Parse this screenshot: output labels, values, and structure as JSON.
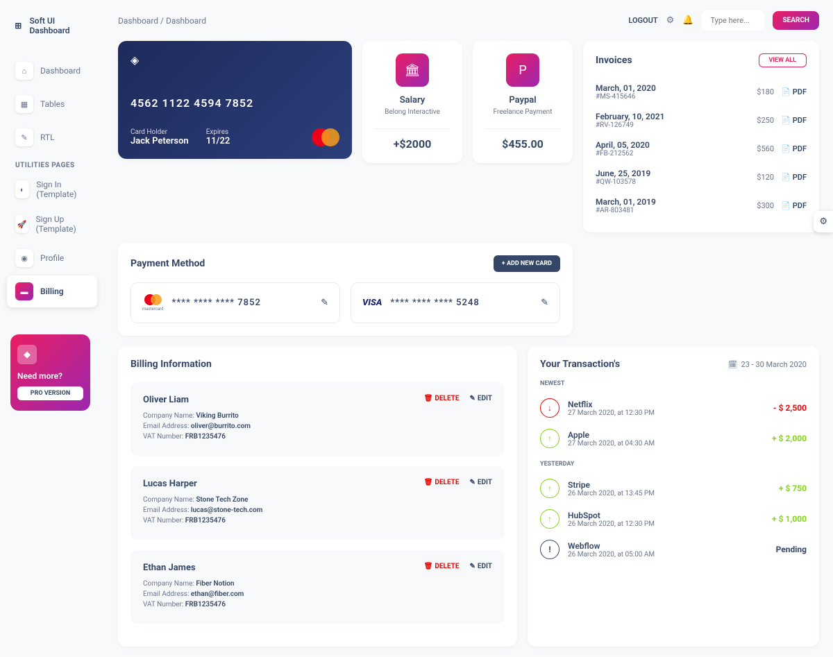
{
  "logo": "Soft UI Dashboard",
  "nav": {
    "items": [
      "Dashboard",
      "Tables",
      "RTL"
    ],
    "section": "UTILITIES PAGES",
    "util_items": [
      "Sign In (Template)",
      "Sign Up (Template)",
      "Profile",
      "Billing"
    ]
  },
  "promo": {
    "title": "Need more?",
    "btn": "PRO VERSION"
  },
  "breadcrumb": {
    "root": "Dashboard",
    "current": "Dashboard"
  },
  "topbar": {
    "logout": "LOGOUT",
    "search_placeholder": "Type here...",
    "search_btn": "SEARCH"
  },
  "credit_card": {
    "number": "4562  1122  4594  7852",
    "holder_label": "Card Holder",
    "holder": "Jack Peterson",
    "exp_label": "Expires",
    "exp": "11/22"
  },
  "stats": [
    {
      "title": "Salary",
      "sub": "Belong Interactive",
      "value": "+$2000"
    },
    {
      "title": "Paypal",
      "sub": "Freelance Payment",
      "value": "$455.00"
    }
  ],
  "invoices": {
    "title": "Invoices",
    "viewall": "VIEW ALL",
    "pdf": "PDF",
    "rows": [
      {
        "date": "March, 01, 2020",
        "id": "#MS-415646",
        "amount": "$180"
      },
      {
        "date": "February, 10, 2021",
        "id": "#RV-126749",
        "amount": "$250"
      },
      {
        "date": "April, 05, 2020",
        "id": "#FB-212562",
        "amount": "$560"
      },
      {
        "date": "June, 25, 2019",
        "id": "#QW-103578",
        "amount": "$120"
      },
      {
        "date": "March, 01, 2019",
        "id": "#AR-803481",
        "amount": "$300"
      }
    ]
  },
  "payment": {
    "title": "Payment Method",
    "add": "+ ADD NEW CARD",
    "mc": "****  ****  ****  7852",
    "mc_label": "mastercard",
    "visa": "****  ****  ****  5248",
    "visa_label": "VISA"
  },
  "billing": {
    "title": "Billing Information",
    "labels": {
      "company": "Company Name:",
      "email": "Email Address:",
      "vat": "VAT Number:"
    },
    "actions": {
      "delete": "DELETE",
      "edit": "EDIT"
    },
    "items": [
      {
        "name": "Oliver Liam",
        "company": "Viking Burrito",
        "email": "oliver@burrito.com",
        "vat": "FRB1235476"
      },
      {
        "name": "Lucas Harper",
        "company": "Stone Tech Zone",
        "email": "lucas@stone-tech.com",
        "vat": "FRB1235476"
      },
      {
        "name": "Ethan James",
        "company": "Fiber Notion",
        "email": "ethan@fiber.com",
        "vat": "FRB1235476"
      }
    ]
  },
  "trans": {
    "title": "Your Transaction's",
    "range": "23 - 30 March 2020",
    "newest": "NEWEST",
    "yesterday": "YESTERDAY",
    "items": [
      {
        "section": "newest",
        "name": "Netflix",
        "date": "27 March 2020, at 12:30 PM",
        "amount": "- $ 2,500",
        "dir": "down",
        "cls": "neg"
      },
      {
        "section": "newest",
        "name": "Apple",
        "date": "27 March 2020, at 04:30 AM",
        "amount": "+ $ 2,000",
        "dir": "up",
        "cls": "pos"
      },
      {
        "section": "yesterday",
        "name": "Stripe",
        "date": "26 March 2020, at 13:45 PM",
        "amount": "+ $ 750",
        "dir": "up",
        "cls": "pos"
      },
      {
        "section": "yesterday",
        "name": "HubSpot",
        "date": "26 March 2020, at 12:30 PM",
        "amount": "+ $ 1,000",
        "dir": "up",
        "cls": "pos"
      },
      {
        "section": "yesterday",
        "name": "Webflow",
        "date": "26 March 2020, at 05:00 AM",
        "amount": "Pending",
        "dir": "pending",
        "cls": "pend"
      }
    ]
  }
}
